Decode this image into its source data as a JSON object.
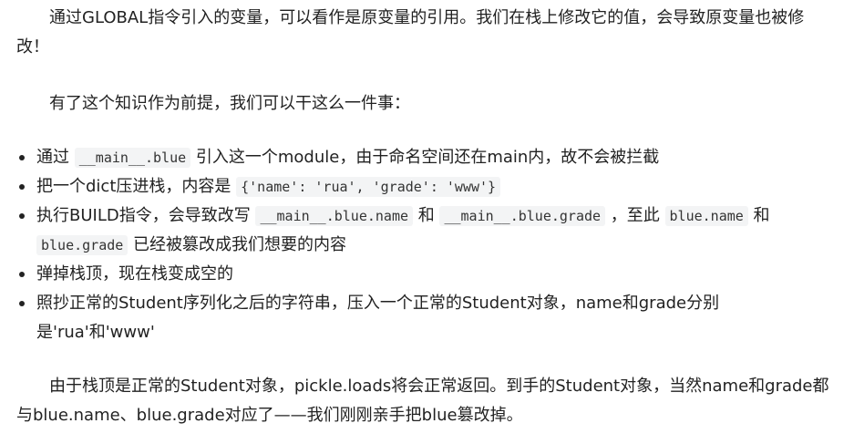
{
  "paragraphs": {
    "p1": "通过GLOBAL指令引入的变量，可以看作是原变量的引用。我们在栈上修改它的值，会导致原变量也被修改！",
    "p2": "有了这个知识作为前提，我们可以干这么一件事：",
    "p3": "由于栈顶是正常的Student对象，pickle.loads将会正常返回。到手的Student对象，当然name和grade都与blue.name、blue.grade对应了——我们刚刚亲手把blue篡改掉。"
  },
  "bullets": {
    "b1": {
      "t1": "通过 ",
      "c1": "__main__.blue",
      "t2": " 引入这一个module，由于命名空间还在main内，故不会被拦截"
    },
    "b2": {
      "t1": "把一个dict压进栈，内容是 ",
      "c1": "{'name': 'rua', 'grade': 'www'}"
    },
    "b3": {
      "t1": "执行BUILD指令，会导致改写 ",
      "c1": "__main__.blue.name",
      "t2": " 和 ",
      "c2": "__main__.blue.grade",
      "t3": " ，至此 ",
      "c3": "blue.name",
      "t4": " 和 ",
      "c4": "blue.grade",
      "t5": " 已经被篡改成我们想要的内容"
    },
    "b4": {
      "t1": "弹掉栈顶，现在栈变成空的"
    },
    "b5": {
      "t1": "照抄正常的Student序列化之后的字符串，压入一个正常的Student对象，name和grade分别是'rua'和'www'"
    }
  }
}
